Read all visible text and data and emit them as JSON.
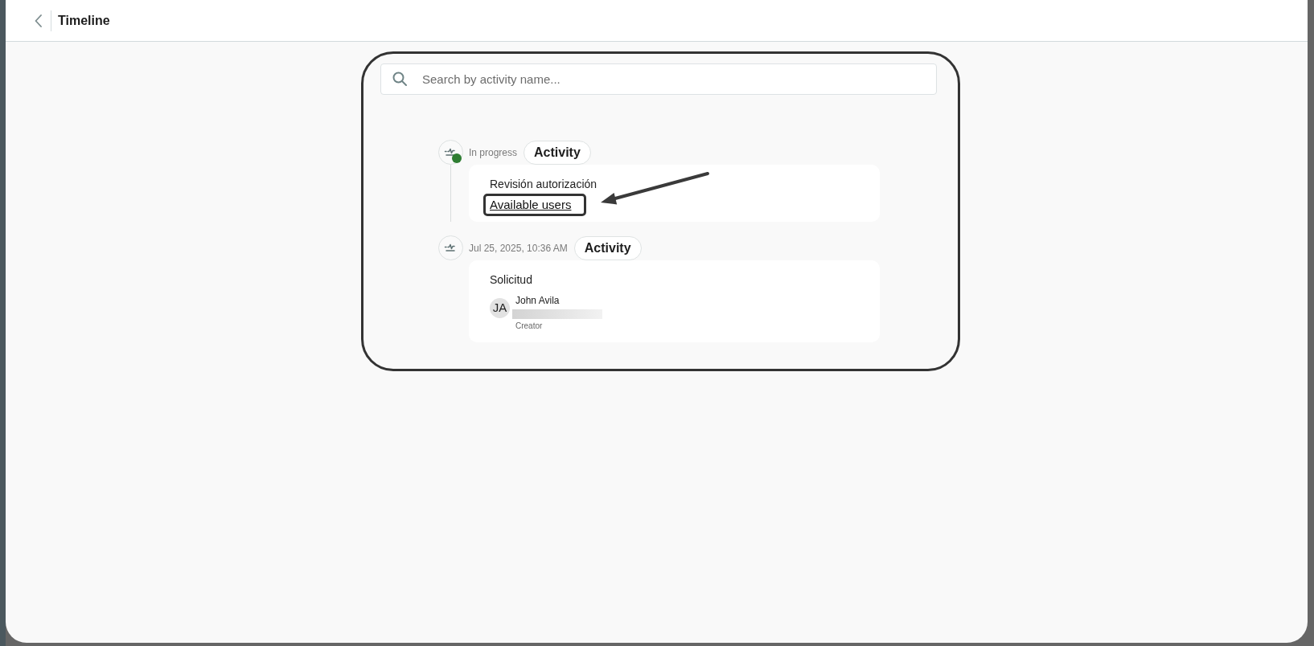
{
  "header": {
    "title": "Timeline"
  },
  "search": {
    "placeholder": "Search by activity name..."
  },
  "timeline": [
    {
      "status_text": "In progress",
      "active": true,
      "tag": "Activity",
      "card": {
        "kind": "link",
        "title": "Revisión autorización",
        "link": {
          "label": "Available users",
          "highlighted": true
        }
      }
    },
    {
      "status_text": "Jul 25, 2025, 10:36 AM",
      "active": false,
      "tag": "Activity",
      "card": {
        "kind": "people",
        "title": "Solicitud",
        "people": [
          {
            "initials": "JA",
            "name": "John Avila",
            "role": "Creator"
          }
        ]
      }
    }
  ]
}
